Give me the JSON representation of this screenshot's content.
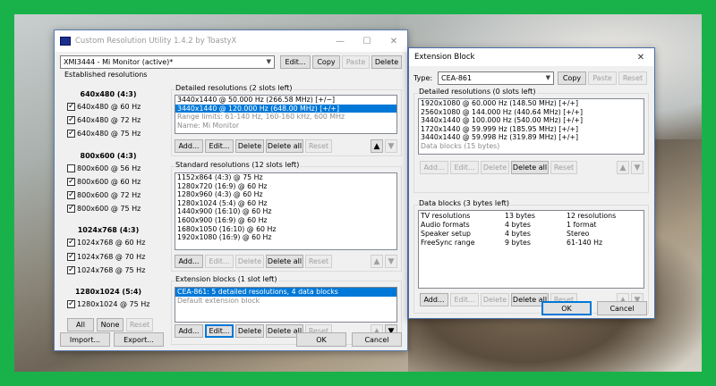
{
  "main_window": {
    "title": "Custom Resolution Utility 1.4.2 by ToastyX",
    "window_buttons": {
      "minimize": "—",
      "maximize": "☐",
      "close": "✕"
    },
    "monitor_select": "XMI3444 - Mi Monitor (active)*",
    "toolbar": {
      "edit": "Edit...",
      "copy": "Copy",
      "paste": "Paste",
      "delete": "Delete"
    },
    "established": {
      "label": "Established resolutions",
      "groups": [
        {
          "title": "640x480 (4:3)",
          "items": [
            {
              "label": "640x480 @ 60 Hz",
              "checked": true
            },
            {
              "label": "640x480 @ 72 Hz",
              "checked": true
            },
            {
              "label": "640x480 @ 75 Hz",
              "checked": true
            }
          ]
        },
        {
          "title": "800x600 (4:3)",
          "items": [
            {
              "label": "800x600 @ 56 Hz",
              "checked": false
            },
            {
              "label": "800x600 @ 60 Hz",
              "checked": true
            },
            {
              "label": "800x600 @ 72 Hz",
              "checked": true
            },
            {
              "label": "800x600 @ 75 Hz",
              "checked": true
            }
          ]
        },
        {
          "title": "1024x768 (4:3)",
          "items": [
            {
              "label": "1024x768 @ 60 Hz",
              "checked": true
            },
            {
              "label": "1024x768 @ 70 Hz",
              "checked": true
            },
            {
              "label": "1024x768 @ 75 Hz",
              "checked": true
            }
          ]
        },
        {
          "title": "1280x1024 (5:4)",
          "items": [
            {
              "label": "1280x1024 @ 75 Hz",
              "checked": true
            }
          ]
        }
      ],
      "buttons": {
        "all": "All",
        "none": "None",
        "reset": "Reset"
      }
    },
    "detailed": {
      "label": "Detailed resolutions (2 slots left)",
      "rows": [
        "3440x1440 @ 50.000 Hz (266.58 MHz) [+/−]",
        "3440x1440 @ 120.000 Hz (648.00 MHz) [+/+]",
        "Range limits: 61-140 Hz, 160-160 kHz, 600 MHz",
        "Name: Mi Monitor"
      ],
      "buttons": {
        "add": "Add...",
        "edit": "Edit...",
        "delete": "Delete",
        "delete_all": "Delete all",
        "reset": "Reset"
      }
    },
    "standard": {
      "label": "Standard resolutions (12 slots left)",
      "rows": [
        "1152x864 (4:3) @ 75 Hz",
        "1280x720 (16:9) @ 60 Hz",
        "1280x960 (4:3) @ 60 Hz",
        "1280x1024 (5:4) @ 60 Hz",
        "1440x900 (16:10) @ 60 Hz",
        "1600x900 (16:9) @ 60 Hz",
        "1680x1050 (16:10) @ 60 Hz",
        "1920x1080 (16:9) @ 60 Hz"
      ],
      "buttons": {
        "add": "Add...",
        "edit": "Edit...",
        "delete": "Delete",
        "delete_all": "Delete all",
        "reset": "Reset"
      }
    },
    "extension": {
      "label": "Extension blocks (1 slot left)",
      "rows": [
        "CEA-861: 5 detailed resolutions, 4 data blocks",
        "Default extension block"
      ],
      "buttons": {
        "add": "Add...",
        "edit": "Edit...",
        "delete": "Delete",
        "delete_all": "Delete all",
        "reset": "Reset"
      }
    },
    "footer": {
      "import": "Import...",
      "export": "Export...",
      "ok": "OK",
      "cancel": "Cancel"
    }
  },
  "ext_window": {
    "title": "Extension Block",
    "close": "✕",
    "type_label": "Type:",
    "type_value": "CEA-861",
    "toolbar": {
      "copy": "Copy",
      "paste": "Paste",
      "reset": "Reset"
    },
    "detailed": {
      "label": "Detailed resolutions (0 slots left)",
      "rows": [
        "1920x1080 @ 60.000 Hz (148.50 MHz) [+/+]",
        "2560x1080 @ 144.000 Hz (440.64 MHz) [+/+]",
        "3440x1440 @ 100.000 Hz (540.00 MHz) [+/+]",
        "1720x1440 @ 59.999 Hz (185.95 MHz) [+/+]",
        "3440x1440 @ 59.998 Hz (319.89 MHz) [+/+]",
        "Data blocks (15 bytes)"
      ],
      "buttons": {
        "add": "Add...",
        "edit": "Edit...",
        "delete": "Delete",
        "delete_all": "Delete all",
        "reset": "Reset"
      }
    },
    "datablocks": {
      "label": "Data blocks (3 bytes left)",
      "rows": [
        [
          "TV resolutions",
          "13 bytes",
          "12 resolutions"
        ],
        [
          "Audio formats",
          "4 bytes",
          "1 format"
        ],
        [
          "Speaker setup",
          "4 bytes",
          "Stereo"
        ],
        [
          "FreeSync range",
          "9 bytes",
          "61-140 Hz"
        ]
      ],
      "buttons": {
        "add": "Add...",
        "edit": "Edit...",
        "delete": "Delete",
        "delete_all": "Delete all",
        "reset": "Reset"
      }
    },
    "footer": {
      "ok": "OK",
      "cancel": "Cancel"
    }
  }
}
